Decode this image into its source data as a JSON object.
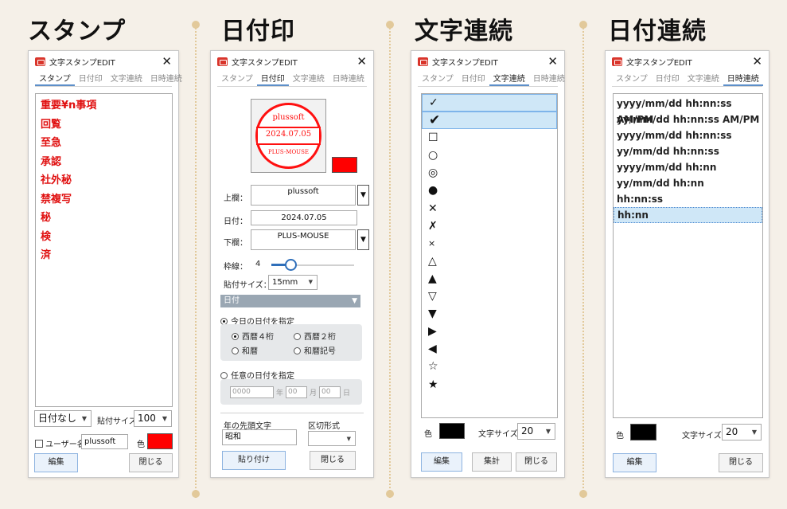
{
  "headings": [
    "スタンプ",
    "日付印",
    "文字連続",
    "日付連続"
  ],
  "window_title": "文字スタンプEDIT",
  "close_glyph": "✕",
  "tabs": [
    "スタンプ",
    "日付印",
    "文字連続",
    "日時連続"
  ],
  "panel1": {
    "items": [
      "重要¥n事項",
      "回覧",
      "至急",
      "承認",
      "社外秘",
      "禁複写",
      "秘",
      "検",
      "済"
    ],
    "date_select": "日付なし",
    "size_label": "貼付サイズ",
    "size_value": "100",
    "user_label": "ユーザー名",
    "user_value": "plussoft",
    "color_label": "色",
    "edit_button": "編集",
    "close_button": "閉じる"
  },
  "panel2": {
    "preview": {
      "top": "plussoft",
      "date": "2024.07.05",
      "bottom": "PLUS-MOUSE"
    },
    "upper_label": "上欄：",
    "upper_value": "plussoft",
    "date_label": "日付：",
    "date_value": "2024.07.05",
    "lower_label": "下欄：",
    "lower_value": "PLUS-MOUSE",
    "border_label": "枠線：",
    "border_value": "4",
    "border_level": 0.23,
    "size_label": "貼付サイズ：",
    "size_value": "15mm",
    "section_title": "日付",
    "today_label": "今日の日付を指定",
    "fmt_options": [
      "西暦４桁",
      "西暦２桁",
      "和暦",
      "和暦記号"
    ],
    "any_label": "任意の日付を指定",
    "year_value": "0000",
    "year_unit": "年",
    "month_value": "00",
    "month_unit": "月",
    "day_value": "00",
    "day_unit": "日",
    "prefix_label": "年の先頭文字",
    "prefix_value": "昭和",
    "sep_label": "区切形式",
    "paste_button": "貼り付け",
    "close_button": "閉じる"
  },
  "panel3": {
    "items": [
      "✓",
      "✔",
      "☐",
      "○",
      "◎",
      "●",
      "✕",
      "✗",
      "×",
      "△",
      "▲",
      "▽",
      "▼",
      "▶",
      "◀",
      "☆",
      "★"
    ],
    "color_label": "色",
    "size_label": "文字サイズ",
    "size_value": "20",
    "edit_button": "編集",
    "count_button": "集計",
    "close_button": "閉じる"
  },
  "panel4": {
    "items": [
      "yyyy/mm/dd hh:nn:ss AM/PM",
      "yy/mm/dd hh:nn:ss AM/PM",
      "yyyy/mm/dd hh:nn:ss",
      "yy/mm/dd hh:nn:ss",
      "yyyy/mm/dd hh:nn",
      "yy/mm/dd hh:nn",
      "hh:nn:ss",
      "hh:nn"
    ],
    "color_label": "色",
    "size_label": "文字サイズ",
    "size_value": "20",
    "edit_button": "編集",
    "close_button": "閉じる"
  },
  "colors": {
    "stamp_red": "#ff0000",
    "accent_blue": "#5d8fc9",
    "divider_tan": "#e2c99a",
    "background": "#f5f0e8"
  },
  "icons": {
    "app": "app-stamp-icon",
    "close": "close-icon",
    "dropdown": "chevron-down-icon"
  }
}
